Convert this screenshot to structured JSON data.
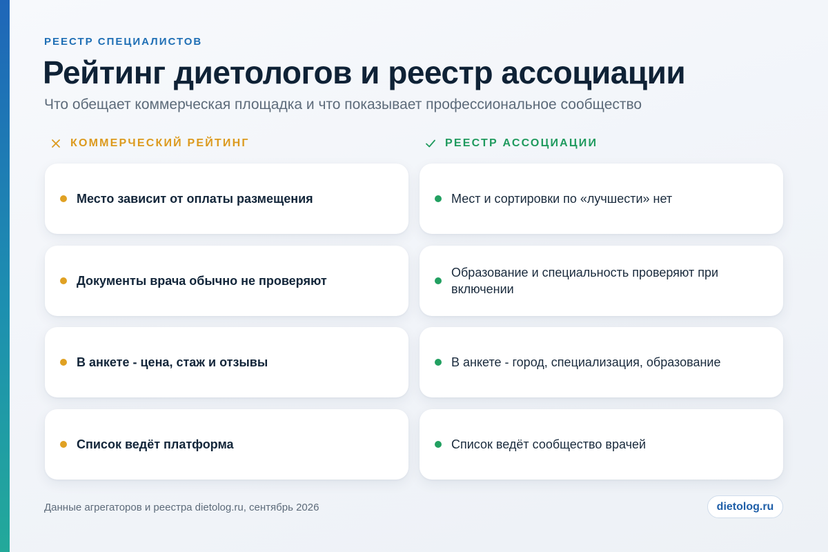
{
  "header": {
    "eyebrow": "РЕЕСТР СПЕЦИАЛИСТОВ",
    "title": "Рейтинг диетологов и реестр ассоциации",
    "subtitle": "Что обещает коммерческая площадка и что показывает профессиональное сообщество"
  },
  "columns": {
    "commercial": {
      "icon": "cross-icon",
      "title": "КОММЕРЧЕСКИЙ РЕЙТИНГ",
      "color": "#dc9a1e",
      "items": [
        "Место зависит от оплаты размещения",
        "Документы врача обычно не проверяют",
        "В анкете - цена, стаж и отзывы",
        "Список ведёт платформа"
      ]
    },
    "registry": {
      "icon": "check-icon",
      "title": "РЕЕСТР АССОЦИАЦИИ",
      "color": "#1f9a5e",
      "items": [
        "Мест и сортировки по «лучшести» нет",
        "Образование и специальность проверяют при включении",
        "В анкете - город, специализация, образование",
        "Список ведёт сообщество врачей"
      ]
    }
  },
  "footer": {
    "note": "Данные агрегаторов и реестра dietolog.ru, сентябрь 2026",
    "badge": "dietolog.ru"
  },
  "colors": {
    "accent_blue": "#1f6fb5",
    "warning_orange": "#dc9a1e",
    "success_green": "#1f9a5e"
  }
}
